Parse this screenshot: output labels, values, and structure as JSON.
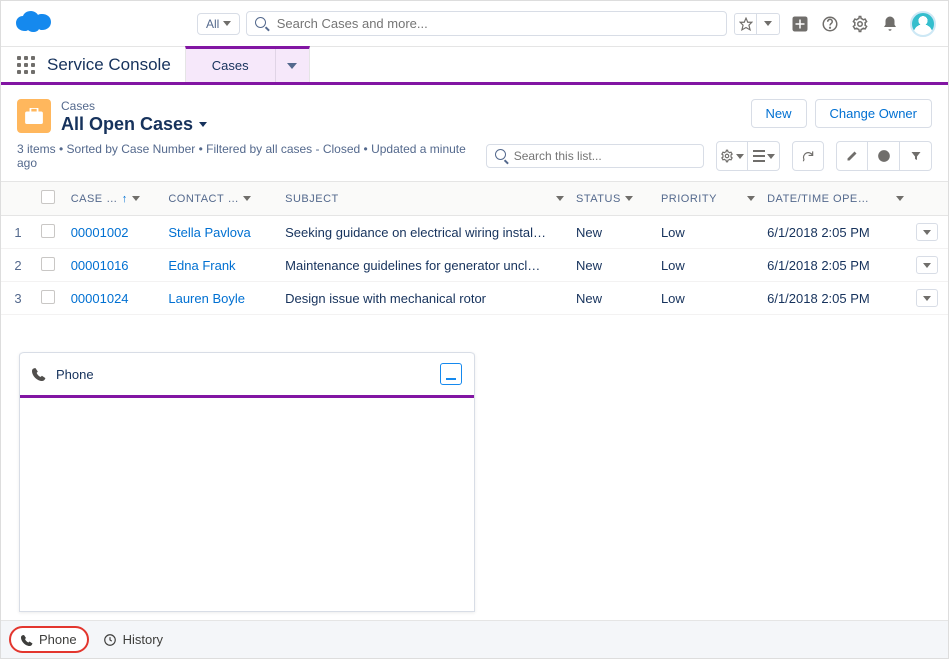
{
  "header": {
    "search_scope": "All",
    "search_placeholder": "Search Cases and more..."
  },
  "nav": {
    "app_name": "Service Console",
    "tab_label": "Cases"
  },
  "page": {
    "object_label": "Cases",
    "list_view": "All Open Cases",
    "meta": "3 items • Sorted by Case Number • Filtered by all cases - Closed • Updated a minute ago",
    "list_search_placeholder": "Search this list...",
    "btn_new": "New",
    "btn_change_owner": "Change Owner"
  },
  "columns": {
    "case_number": "CASE …",
    "contact": "CONTACT …",
    "subject": "SUBJECT",
    "status": "STATUS",
    "priority": "PRIORITY",
    "datetime": "DATE/TIME OPE…"
  },
  "rows": [
    {
      "num": "1",
      "case": "00001002",
      "contact": "Stella Pavlova",
      "subject": "Seeking guidance on electrical wiring instal…",
      "status": "New",
      "priority": "Low",
      "dt": "6/1/2018 2:05 PM"
    },
    {
      "num": "2",
      "case": "00001016",
      "contact": "Edna Frank",
      "subject": "Maintenance guidelines for generator uncl…",
      "status": "New",
      "priority": "Low",
      "dt": "6/1/2018 2:05 PM"
    },
    {
      "num": "3",
      "case": "00001024",
      "contact": "Lauren Boyle",
      "subject": "Design issue with mechanical rotor",
      "status": "New",
      "priority": "Low",
      "dt": "6/1/2018 2:05 PM"
    }
  ],
  "phone_panel": {
    "title": "Phone"
  },
  "utility": {
    "phone": "Phone",
    "history": "History"
  }
}
